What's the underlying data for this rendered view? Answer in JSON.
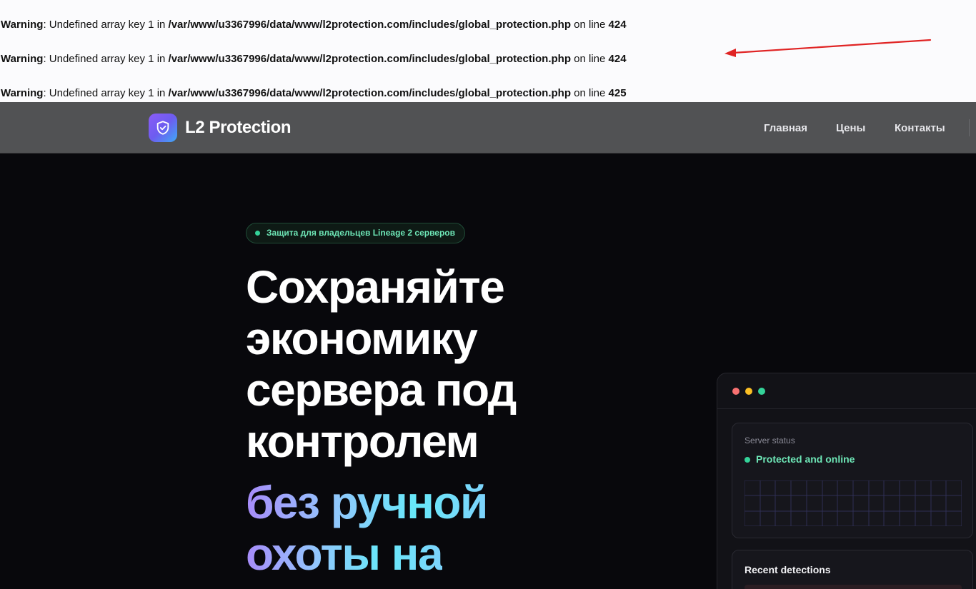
{
  "warnings": [
    {
      "label": "Warning",
      "message": ": Undefined array key 1 in ",
      "path": "/var/www/u3367996/data/www/l2protection.com/includes/global_protection.php",
      "on_line": " on line ",
      "line": "424"
    },
    {
      "label": "Warning",
      "message": ": Undefined array key 1 in ",
      "path": "/var/www/u3367996/data/www/l2protection.com/includes/global_protection.php",
      "on_line": " on line ",
      "line": "424"
    },
    {
      "label": "Warning",
      "message": ": Undefined array key 1 in ",
      "path": "/var/www/u3367996/data/www/l2protection.com/includes/global_protection.php",
      "on_line": " on line ",
      "line": "425"
    }
  ],
  "annotation": {
    "arrow_color": "#e02424"
  },
  "header": {
    "logo_icon": "shield-check-icon",
    "brand": "L2 Protection",
    "nav": [
      "Главная",
      "Цены",
      "Контакты"
    ]
  },
  "hero": {
    "badge": "Защита для владельцев Lineage 2 серверов",
    "lines": [
      "Сохраняйте",
      "экономику",
      "сервера под",
      "контролем"
    ],
    "accent_lines": [
      "без ручной",
      "охоты на"
    ]
  },
  "dashboard": {
    "status_label": "Server status",
    "status_value": "Protected and online",
    "detections_title": "Recent detections"
  },
  "colors": {
    "accent_green": "#34d399",
    "brand_gradient_start": "#8b5cf6",
    "brand_gradient_end": "#3fa9f5",
    "hero_gradient_start": "#a78bfa",
    "hero_gradient_end": "#67e8f9"
  }
}
